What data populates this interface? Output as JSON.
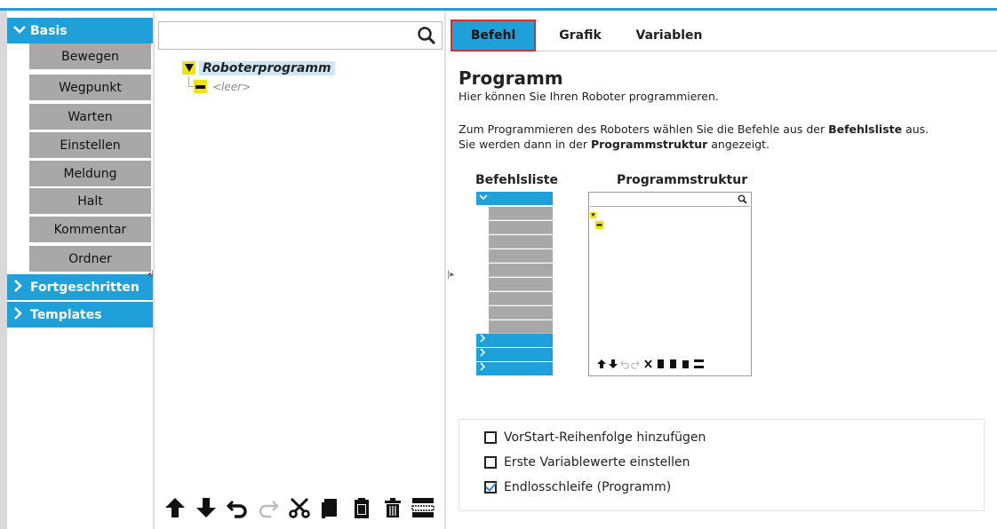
{
  "commands": {
    "basis_label": "Basis",
    "items": [
      "Bewegen",
      "Wegpunkt",
      "Warten",
      "Einstellen",
      "Meldung",
      "Halt",
      "Kommentar",
      "Ordner"
    ],
    "advanced_label": "Fortgeschritten",
    "templates_label": "Templates"
  },
  "tree": {
    "search_placeholder": "",
    "root_label": "Roboterprogramm",
    "empty_label": "<leer>"
  },
  "tabs": [
    "Befehl",
    "Grafik",
    "Variablen"
  ],
  "content": {
    "heading": "Programm",
    "intro": "Hier können Sie Ihren Roboter programmieren.",
    "line1_pre": "Zum Programmieren des Roboters wählen Sie die Befehle aus der ",
    "line1_bold": "Befehlsliste",
    "line1_post": " aus.",
    "line2_pre": "Sie werden dann in der ",
    "line2_bold": "Programmstruktur",
    "line2_post": " angezeigt.",
    "mini_left_title": "Befehlsliste",
    "mini_right_title": "Programmstruktur"
  },
  "options": {
    "prestart": "VorStart-Reihenfolge hinzufügen",
    "initial_vars": "Erste Variablewerte einstellen",
    "loop": "Endlosschleife (Programm)"
  },
  "colors": {
    "accent": "#1fa0d8",
    "tab_highlight": "#d43030",
    "tree_node": "#f1e11b"
  }
}
